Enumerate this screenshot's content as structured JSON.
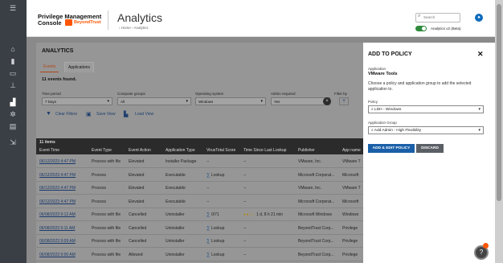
{
  "nav": {
    "icons": [
      "menu-icon",
      "home-icon",
      "chart-icon",
      "monitor-icon",
      "hierarchy-icon",
      "analytics-icon",
      "gear-icon",
      "clipboard-icon",
      "user-exit-icon"
    ]
  },
  "header": {
    "brand_line1": "Privilege Management",
    "brand_line2": "Console",
    "brand_logo_text": "BeyondTrust",
    "title": "Analytics",
    "breadcrumb": "›  Home  ›  Analytics",
    "search_placeholder": "Search",
    "toggle_label": "Analytics v2 (Beta)"
  },
  "main": {
    "title": "ANALYTICS",
    "tabs": [
      "Events",
      "Applications"
    ],
    "count_text": "11 events found.",
    "filters": [
      {
        "label": "Time period",
        "value": "7 Days"
      },
      {
        "label": "Computer groups",
        "value": "All"
      },
      {
        "label": "Operating system",
        "value": "Windows"
      },
      {
        "label": "Admin required",
        "value": "Yes"
      },
      {
        "label": "Filter by",
        "value": "Y"
      }
    ],
    "actions": {
      "clear": "Clear Filters",
      "save": "Save View",
      "load": "Load View"
    },
    "table": {
      "items_label": "11 items",
      "columns": [
        "Event Time",
        "Event Type",
        "Event Action",
        "Application Type",
        "VirusTotal Score",
        "Time Since Last Lookup",
        "Publisher",
        "App name"
      ],
      "rows": [
        [
          "06/12/2023 4:47 PM",
          "Process with file",
          "Elevated",
          "Installer Package",
          "--",
          "--",
          "VMware, Inc.",
          "VMware T"
        ],
        [
          "06/12/2023 4:47 PM",
          "Process",
          "Elevated",
          "Executable",
          "Lookup",
          "--",
          "Microsoft Corporat...",
          "Microsoft"
        ],
        [
          "06/12/2023 4:47 PM",
          "Process",
          "Elevated",
          "Executable",
          "--",
          "--",
          "VMware, Inc.",
          "VMware T"
        ],
        [
          "06/12/2023 4:47 PM",
          "Process",
          "Elevated",
          "Executable",
          "--",
          "--",
          "Microsoft Corporat...",
          "Microsoft"
        ],
        [
          "06/08/2023 9:12 AM",
          "Process with file",
          "Cancelled",
          "Uninstaller",
          "0/71",
          "1 d, 8 h 21 min",
          "Microsoft Windows",
          "Windows"
        ],
        [
          "06/08/2023 9:11 AM",
          "Process with file",
          "Cancelled",
          "Uninstaller",
          "Lookup",
          "--",
          "BeyondTrust Corp...",
          "Privilege"
        ],
        [
          "06/08/2023 9:09 AM",
          "Process with file",
          "Cancelled",
          "Uninstaller",
          "Lookup",
          "--",
          "BeyondTrust Corp...",
          "Privilege"
        ],
        [
          "06/08/2023 9:00 AM",
          "Process with file",
          "Allowed",
          "Uninstaller",
          "Lookup",
          "--",
          "BeyondTrust Corp...",
          "Privilege"
        ]
      ]
    }
  },
  "panel": {
    "title": "ADD TO POLICY",
    "app_label": "Application",
    "app_value": "VMware Tools",
    "description": "Choose a policy and application group to add the selected application to.",
    "policy_label": "Policy",
    "policy_value": "LDH - Windows",
    "group_label": "Application Group",
    "group_value": "Add Admin - High Flexibility",
    "primary_button": "ADD & EDIT POLICY",
    "secondary_button": "DISCARD"
  },
  "colors": {
    "accent": "#1a5fa8",
    "brand_orange": "#ff5500",
    "toggle_on": "#2e8b3d"
  }
}
